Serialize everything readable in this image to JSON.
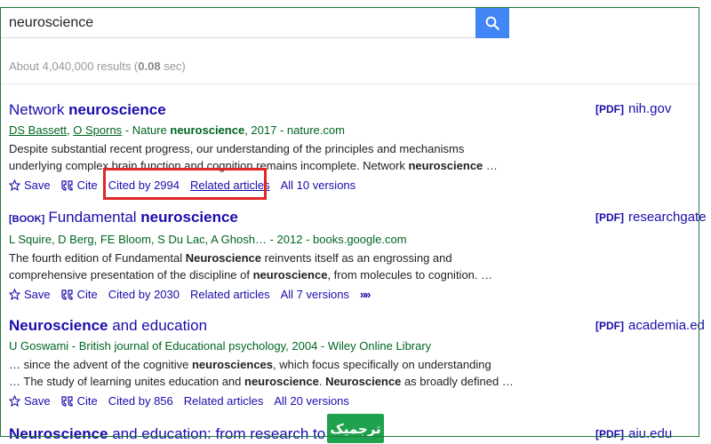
{
  "search": {
    "query": "neuroscience"
  },
  "stats": {
    "prefix": "About 4,040,000 results (",
    "time": "0.08",
    "suffix": " sec)"
  },
  "actions": {
    "save": "Save",
    "cite": "Cite"
  },
  "results": [
    {
      "title_pre": "Network ",
      "title_bold": "neuroscience",
      "title_post": "",
      "authors": [
        {
          "name": "DS Bassett",
          "linked": true
        },
        {
          "name": "O Sporns",
          "linked": true
        }
      ],
      "source": " - Nature ",
      "source_bold": "neuroscience",
      "source_post": ", 2017 - nature.com",
      "snippet1": "Despite substantial recent progress, our understanding of the principles and mechanisms",
      "snippet2_pre": "underlying complex brain function and cognition remains incomplete. Network ",
      "snippet2_bold": "neuroscience",
      "snippet2_post": " …",
      "cited": "Cited by 2994",
      "related": "Related articles",
      "versions": "All 10 versions",
      "pdf_tag": "[PDF]",
      "pdf_domain": "nih.gov"
    },
    {
      "book_tag": "[BOOK]",
      "title_pre": "Fundamental ",
      "title_bold": "neuroscience",
      "authors_line": "L Squire, D Berg, FE Bloom, S Du Lac, A Ghosh… - 2012 - books.google.com",
      "snippet1_pre": "The fourth edition of Fundamental ",
      "snippet1_bold": "Neuroscience",
      "snippet1_post": " reinvents itself as an engrossing and",
      "snippet2_pre": "comprehensive presentation of the discipline of ",
      "snippet2_bold": "neuroscience",
      "snippet2_post": ", from molecules to cognition. …",
      "cited": "Cited by 2030",
      "related": "Related articles",
      "versions": "All 7 versions",
      "pdf_tag": "[PDF]",
      "pdf_domain": "researchgate"
    },
    {
      "title_bold": "Neuroscience",
      "title_post": " and education",
      "authors_line": "U Goswami - British journal of Educational psychology, 2004 - Wiley Online Library",
      "snippet1_pre": "… since the advent of the cognitive ",
      "snippet1_bold": "neurosciences",
      "snippet1_post": ", which focus specifically on understanding",
      "snippet2_pre": "… The study of learning unites education and ",
      "snippet2_bold": "neuroscience",
      "snippet2_mid": ". ",
      "snippet2_bold2": "Neuroscience",
      "snippet2_post": " as broadly defined …",
      "cited": "Cited by 856",
      "related": "Related articles",
      "versions": "All 20 versions",
      "pdf_tag": "[PDF]",
      "pdf_domain": "academia.ed"
    },
    {
      "title_bold": "Neuroscience",
      "title_post": " and education: from research to pr",
      "pdf_tag": "[PDF]",
      "pdf_domain": "aiu.edu"
    }
  ],
  "badge": {
    "text": "ترجمیک"
  },
  "colors": {
    "link": "#1a0dab",
    "green": "#006621",
    "accent": "#4285f4",
    "highlight": "#e02828",
    "badge": "#1ea24e"
  }
}
